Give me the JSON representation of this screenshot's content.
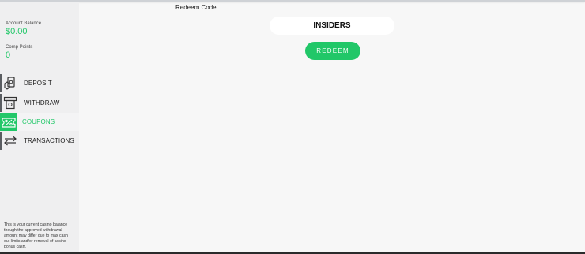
{
  "colors": {
    "accent": "#21c768",
    "sidebar_bg": "#efeff0",
    "main_bg": "#f7f7f7"
  },
  "sidebar": {
    "account_balance_label": "Account Balance",
    "account_balance_value": "$0.00",
    "comp_points_label": "Comp Points",
    "comp_points_value": "0",
    "nav": [
      {
        "label": "DEPOSIT",
        "icon": "deposit-icon",
        "active": false
      },
      {
        "label": "WITHDRAW",
        "icon": "withdraw-icon",
        "active": false
      },
      {
        "label": "COUPONS",
        "icon": "coupon-icon",
        "active": true
      },
      {
        "label": "TRANSACTIONS",
        "icon": "transactions-icon",
        "active": false
      }
    ],
    "disclaimer": "This is your current casino balance though the approved withdrawal amount may differ due to max cash out limits and/or removal of casino bonus cash."
  },
  "main": {
    "title": "Redeem Code",
    "code_input_value": "INSIDERS",
    "redeem_button_label": "REDEEM"
  }
}
